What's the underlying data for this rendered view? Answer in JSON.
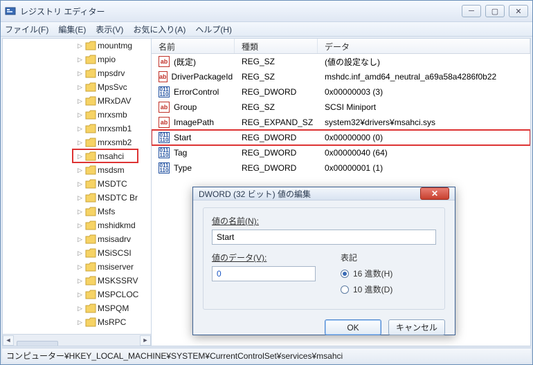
{
  "window": {
    "title": "レジストリ エディター"
  },
  "menu": {
    "file": "ファイル(F)",
    "edit": "編集(E)",
    "view": "表示(V)",
    "fav": "お気に入り(A)",
    "help": "ヘルプ(H)"
  },
  "tree": {
    "items": [
      {
        "label": "mountmg"
      },
      {
        "label": "mpio"
      },
      {
        "label": "mpsdrv"
      },
      {
        "label": "MpsSvc"
      },
      {
        "label": "MRxDAV"
      },
      {
        "label": "mrxsmb"
      },
      {
        "label": "mrxsmb1"
      },
      {
        "label": "mrxsmb2"
      },
      {
        "label": "msahci",
        "highlight": true
      },
      {
        "label": "msdsm"
      },
      {
        "label": "MSDTC"
      },
      {
        "label": "MSDTC Br"
      },
      {
        "label": "Msfs"
      },
      {
        "label": "mshidkmd"
      },
      {
        "label": "msisadrv"
      },
      {
        "label": "MSiSCSI"
      },
      {
        "label": "msiserver"
      },
      {
        "label": "MSKSSRV"
      },
      {
        "label": "MSPCLOC"
      },
      {
        "label": "MSPQM"
      },
      {
        "label": "MsRPC"
      }
    ]
  },
  "list": {
    "headers": {
      "name": "名前",
      "type": "種類",
      "data": "データ"
    },
    "rows": [
      {
        "icon": "str",
        "name": "(既定)",
        "type": "REG_SZ",
        "data": "(値の設定なし)"
      },
      {
        "icon": "str",
        "name": "DriverPackageId",
        "type": "REG_SZ",
        "data": "mshdc.inf_amd64_neutral_a69a58a4286f0b22"
      },
      {
        "icon": "bin",
        "name": "ErrorControl",
        "type": "REG_DWORD",
        "data": "0x00000003 (3)"
      },
      {
        "icon": "str",
        "name": "Group",
        "type": "REG_SZ",
        "data": "SCSI Miniport"
      },
      {
        "icon": "str",
        "name": "ImagePath",
        "type": "REG_EXPAND_SZ",
        "data": "system32¥drivers¥msahci.sys"
      },
      {
        "icon": "bin",
        "name": "Start",
        "type": "REG_DWORD",
        "data": "0x00000000 (0)",
        "highlight": true
      },
      {
        "icon": "bin",
        "name": "Tag",
        "type": "REG_DWORD",
        "data": "0x00000040 (64)"
      },
      {
        "icon": "bin",
        "name": "Type",
        "type": "REG_DWORD",
        "data": "0x00000001 (1)"
      }
    ]
  },
  "dialog": {
    "title": "DWORD (32 ビット) 値の編集",
    "name_label": "値の名前(N):",
    "name_value": "Start",
    "data_label": "値のデータ(V):",
    "data_value": "0",
    "radix_label": "表記",
    "hex_label": "16 進数(H)",
    "dec_label": "10 進数(D)",
    "ok": "OK",
    "cancel": "キャンセル"
  },
  "status": {
    "path": "コンピューター¥HKEY_LOCAL_MACHINE¥SYSTEM¥CurrentControlSet¥services¥msahci"
  }
}
